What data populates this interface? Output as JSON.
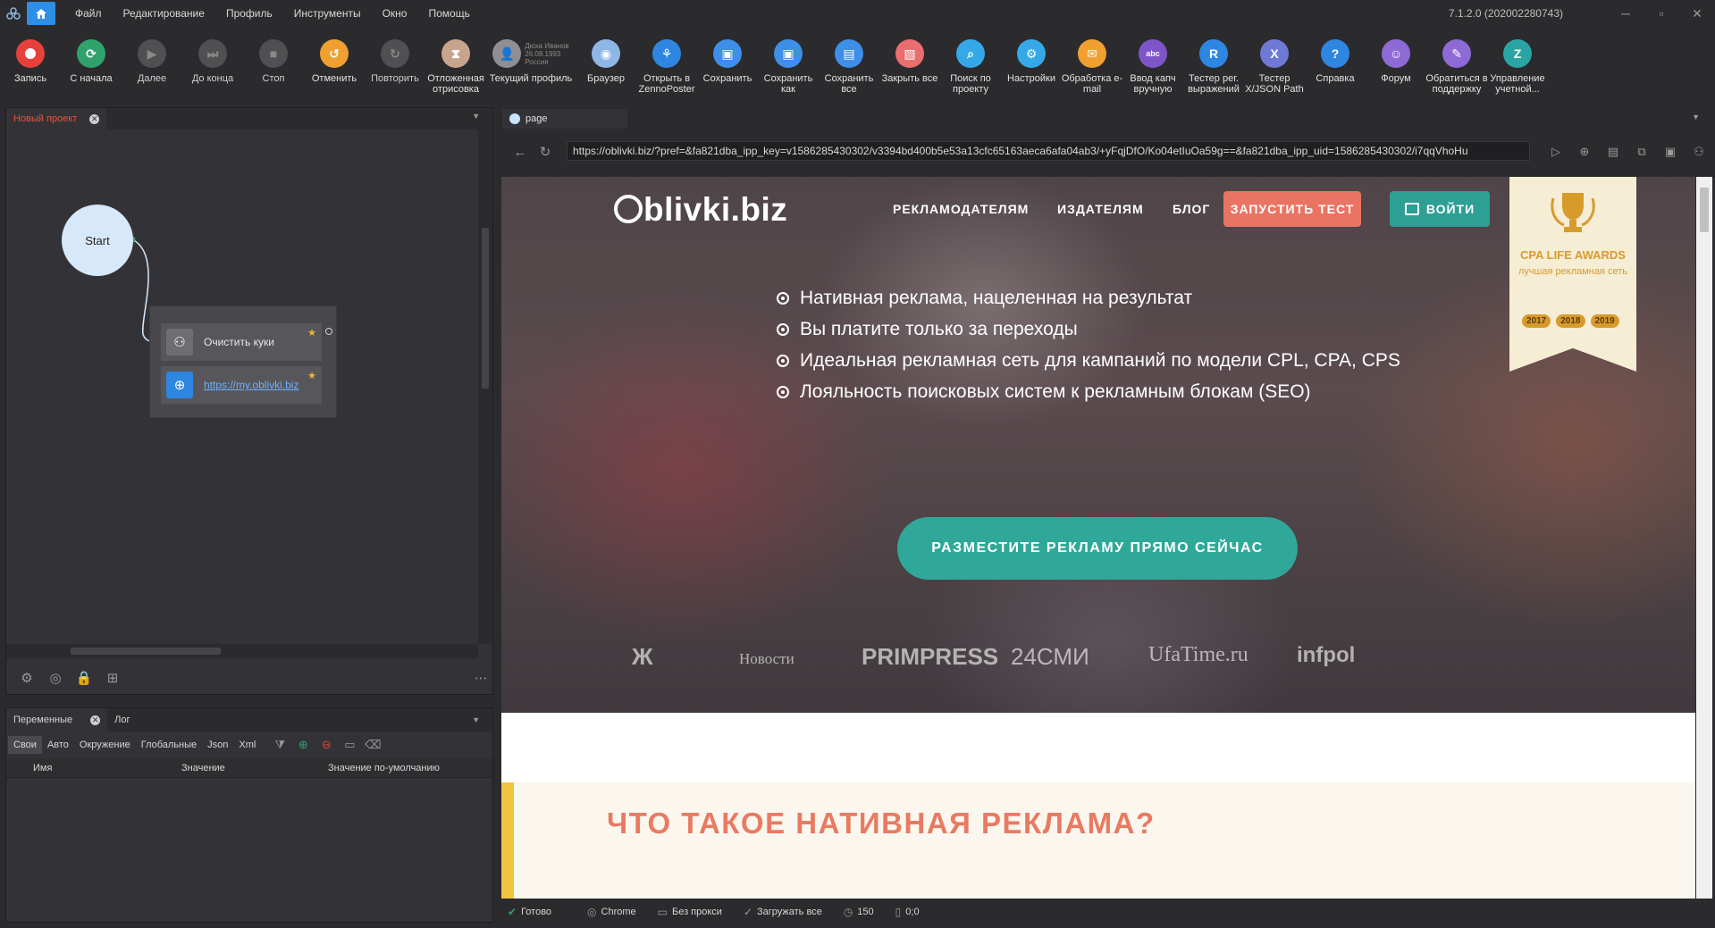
{
  "menu": {
    "items": [
      "Файл",
      "Редактирование",
      "Профиль",
      "Инструменты",
      "Окно",
      "Помощь"
    ],
    "version": "7.1.2.0 (202002280743)"
  },
  "toolbar": {
    "record": "Запись",
    "from_start": "С начала",
    "next": "Далее",
    "to_end": "До конца",
    "stop": "Стоп",
    "undo": "Отменить",
    "redo": "Повторить",
    "deferred": "Отложенная отрисовка",
    "profile": "Текущий профиль",
    "profile_info": [
      "Дюха Иванов",
      "26.08.1993",
      "Россия"
    ],
    "browser": "Браузер",
    "open_zp": "Открыть в ZennoPoster",
    "save": "Сохранить",
    "save_as": "Сохранить как",
    "save_all": "Сохранить все",
    "close_all": "Закрыть все",
    "search": "Поиск по проекту",
    "settings": "Настройки",
    "email": "Обработка e-mail",
    "captcha": "Ввод капч вручную",
    "regex": "Тестер рег. выражений",
    "xpath": "Тестер X/JSON Path",
    "help": "Справка",
    "forum": "Форум",
    "support": "Обратиться в поддержку",
    "account": "Управление учетной..."
  },
  "colors": {
    "record": "#e8403a",
    "from_start": "#2fa36b",
    "undo": "#f0a030",
    "deferred": "#c9a48c",
    "profile": "#8f8f93",
    "browser": "#8fb7e6",
    "open_zp": "#2f86e0",
    "save": "#3d8fe8",
    "close_all": "#e96e6e",
    "search": "#35a9e8",
    "settings": "#35a9e8",
    "email": "#f0a030",
    "captcha": "#7e55c8",
    "regex": "#2f86e0",
    "xpath": "#6f7ad6",
    "help": "#2f86e0",
    "forum": "#8e6ad6",
    "support": "#8e6ad6",
    "account": "#2aa5a3",
    "accent": "#2f8ee6",
    "project_tab": "#e5533d"
  },
  "project": {
    "tab_title": "Новый проект",
    "start_label": "Start",
    "block1": "Очистить куки",
    "block2": "https://my.oblivki.biz"
  },
  "variables": {
    "tabs": [
      "Переменные",
      "Лог"
    ],
    "subtabs": [
      "Свои",
      "Авто",
      "Окружение",
      "Глобальные",
      "Json",
      "Xml"
    ],
    "columns": [
      "Имя",
      "Значение",
      "Значение по-умолчанию"
    ]
  },
  "browser": {
    "tab_title": "page",
    "url": "https://oblivki.biz/?pref=&fa821dba_ipp_key=v1586285430302/v3394bd400b5e53a13cfc65163aeca6afa04ab3/+yFqjDfO/Ko04etIuOa59g==&fa821dba_ipp_uid=1586285430302/i7qqVhoHu"
  },
  "site": {
    "logo": "blivki.biz",
    "nav": [
      "РЕКЛАМОДАТЕЛЯМ",
      "ИЗДАТЕЛЯМ",
      "БЛОГ"
    ],
    "btn_test": "ЗАПУСТИТЬ ТЕСТ",
    "btn_login": "ВОЙТИ",
    "award_title": "CPA LIFE AWARDS",
    "award_sub": "лучшая рекламная сеть",
    "award_years": [
      "2017",
      "2018",
      "2019"
    ],
    "bullets": [
      "Нативная реклама, нацеленная на результат",
      "Вы платите только за переходы",
      "Идеальная рекламная сеть для кампаний по модели CPL, CPA, CPS",
      "Лояльность поисковых систем к рекламным блокам (SEO)"
    ],
    "cta": "РАЗМЕСТИТЕ РЕКЛАМУ ПРЯМО СЕЙЧАС",
    "partners": [
      "Ж",
      "Новости",
      "PRIMPRESS",
      "24СМИ",
      "UfaTime.ru",
      "infpol"
    ],
    "section_heading": "ЧТО ТАКОЕ НАТИВНАЯ РЕКЛАМА?"
  },
  "statusbar": {
    "ready": "Готово",
    "engine": "Chrome",
    "proxy": "Без прокси",
    "load": "Загружать все",
    "timeout": "150",
    "coords": "0;0"
  }
}
